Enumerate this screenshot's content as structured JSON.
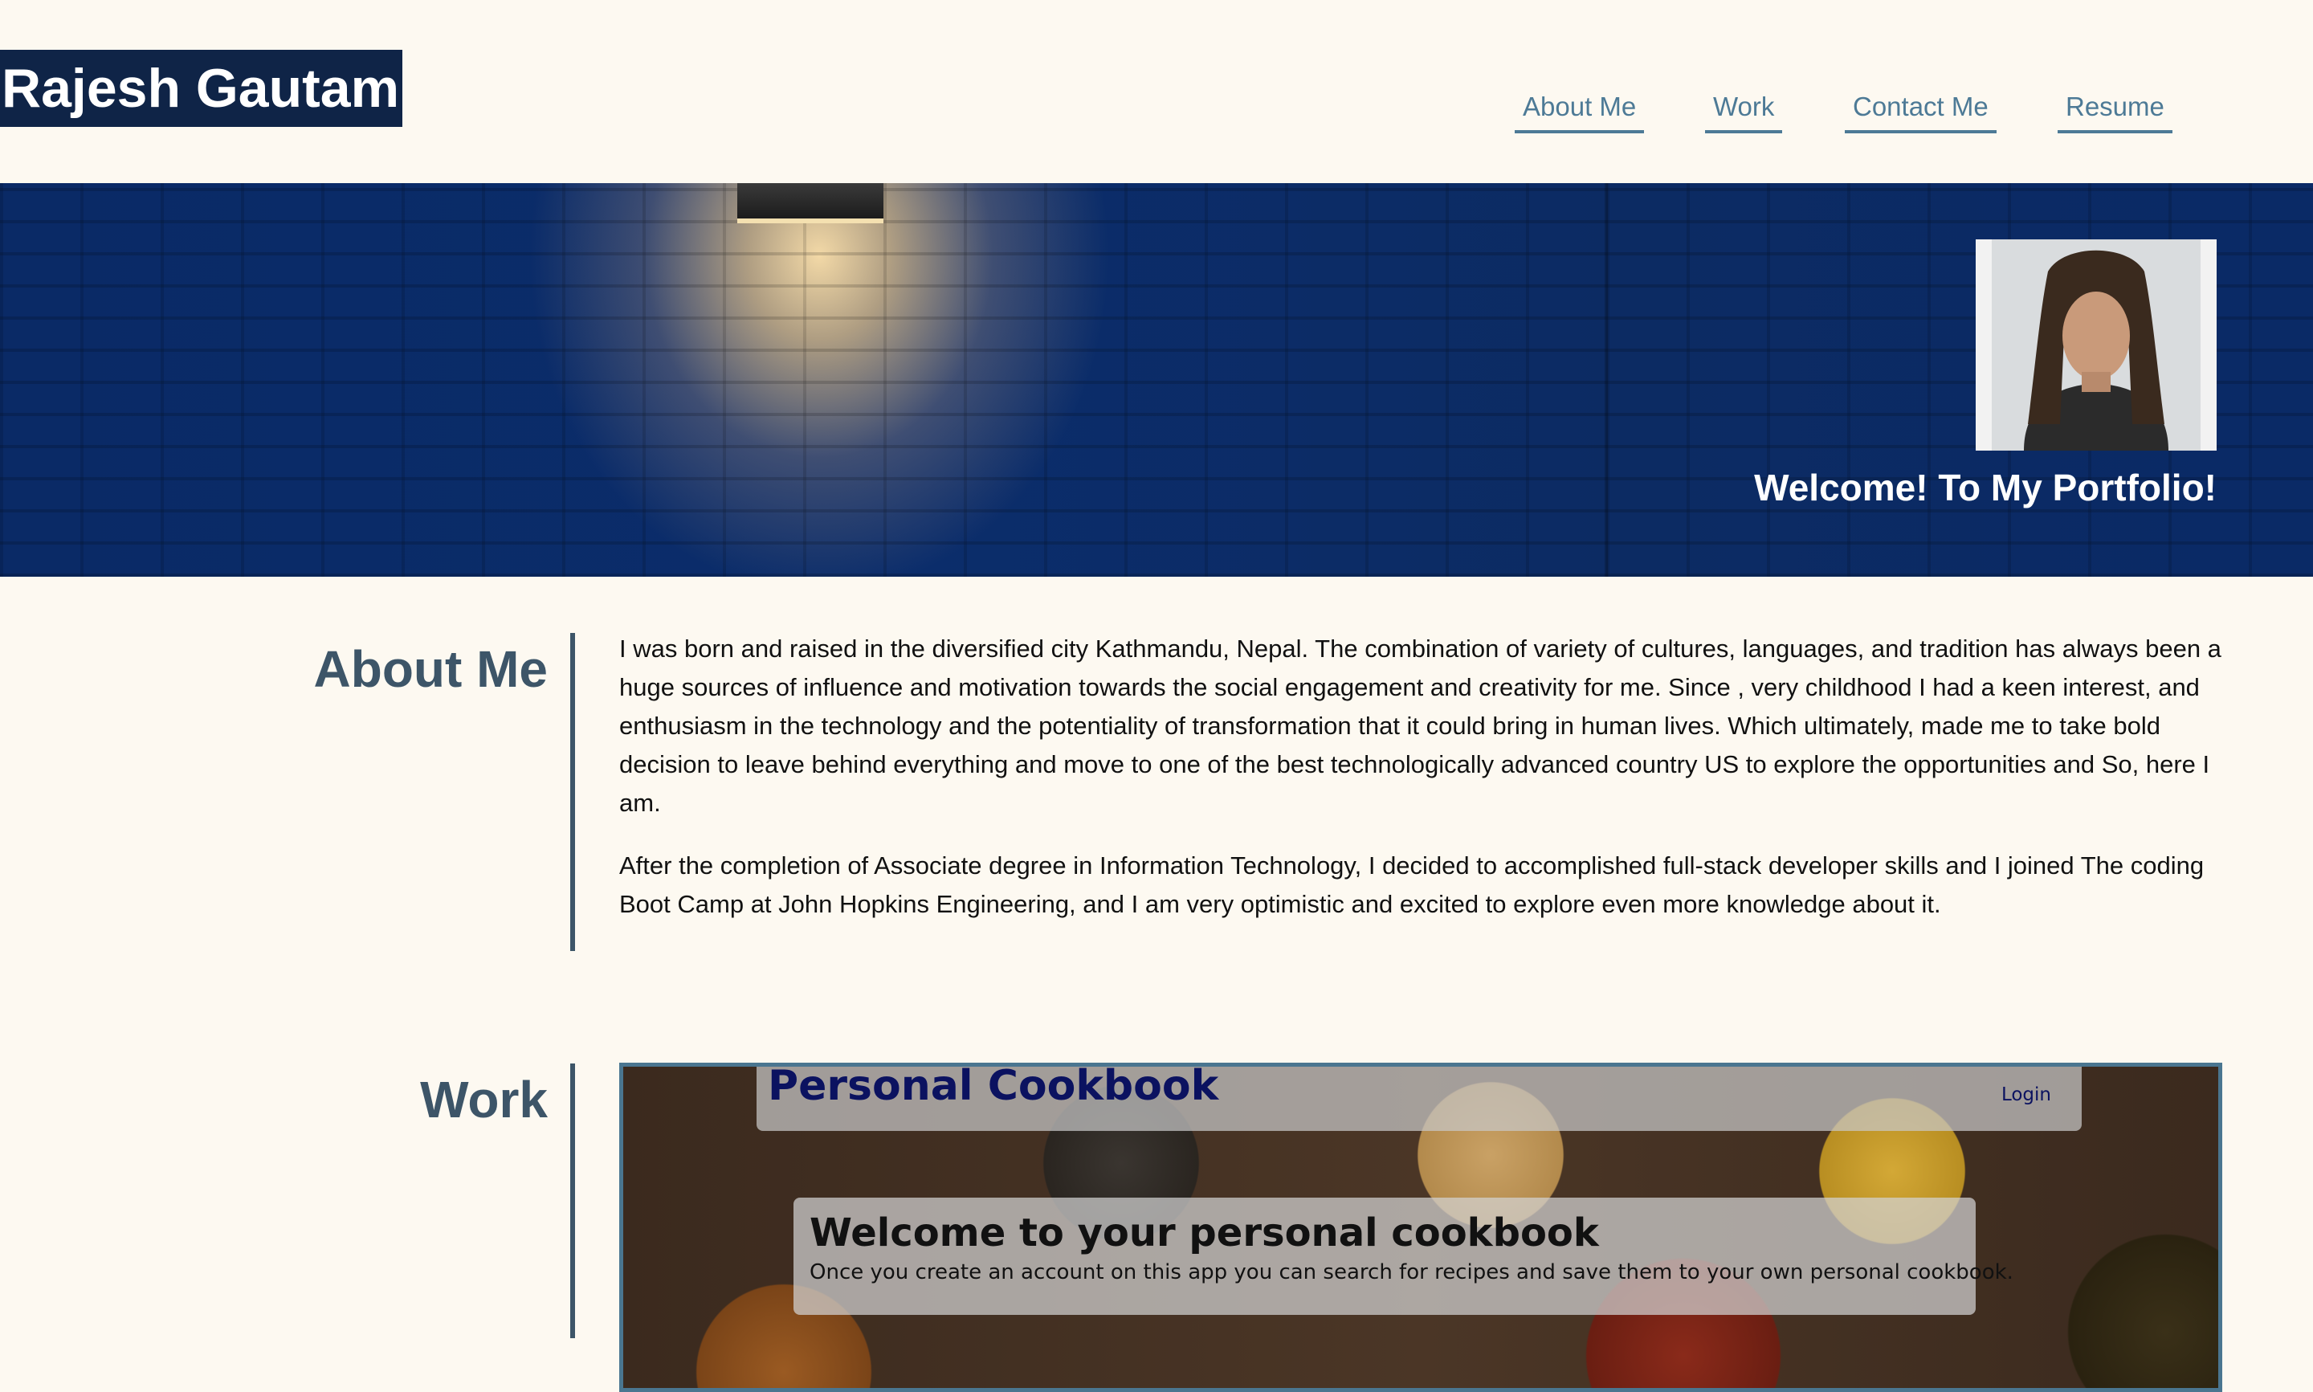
{
  "header": {
    "brand": "Rajesh Gautam",
    "nav": [
      "About Me",
      "Work",
      "Contact Me",
      "Resume"
    ]
  },
  "hero": {
    "title": "Welcome! To My Portfolio!",
    "avatar_alt": "profile photo"
  },
  "about": {
    "title": "About Me",
    "paragraphs": [
      "I was born and raised in the diversified city Kathmandu, Nepal. The combination of variety of cultures, languages, and tradition has always been a huge sources of influence and motivation towards the social engagement and creativity for me. Since , very childhood I had a keen interest, and enthusiasm in the technology and the potentiality of transformation that it could bring in human lives. Which ultimately, made me to take bold decision to leave behind everything and move to one of the best technologically advanced country US to explore the opportunities and So, here I am.",
      "After the completion of Associate degree in Information Technology, I decided to accomplished full-stack developer skills and I joined The coding Boot Camp at John Hopkins Engineering, and I am very optimistic and excited to explore even more knowledge about it."
    ]
  },
  "work": {
    "title": "Work",
    "project": {
      "app_title": "Personal Cookbook",
      "login_label": "Login",
      "welcome_heading": "Welcome to your personal cookbook",
      "welcome_text": "Once you create an account on this app you can search for recipes and save them to your own personal cookbook."
    }
  },
  "colors": {
    "background": "#fdf9f1",
    "brand_bg": "#0f2447",
    "nav_link": "#4d7a96",
    "section_title": "#3d5568",
    "hero_bg": "#0b2d6b"
  }
}
